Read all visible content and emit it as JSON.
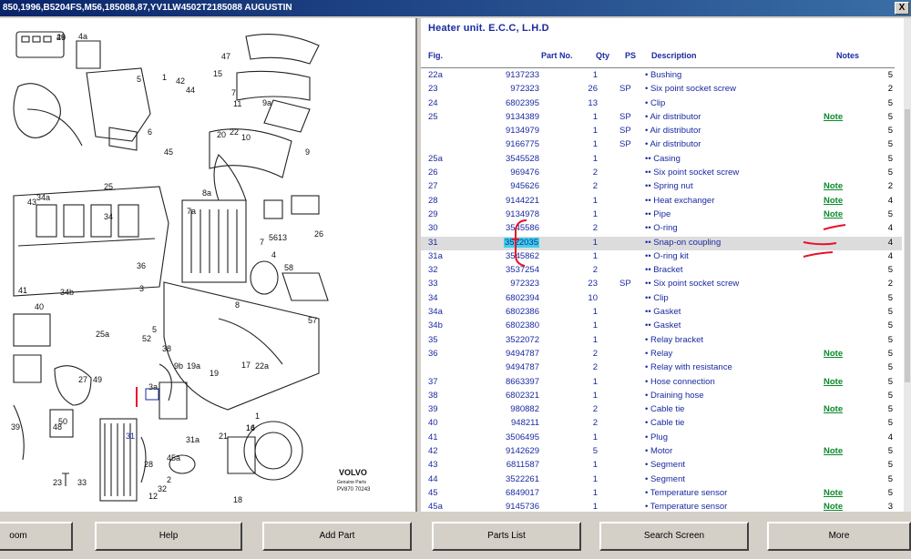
{
  "window": {
    "title": "850,1996,B5204FS,M56,185088,87,YV1LW4502T2185088 AUGUSTIN",
    "close_label": "X"
  },
  "diagram": {
    "callouts": [
      "46",
      "4a",
      "5",
      "1",
      "47",
      "15",
      "42",
      "44",
      "11",
      "9a",
      "7",
      "6",
      "10",
      "20",
      "22",
      "9",
      "45",
      "34a",
      "25",
      "8a",
      "7a",
      "34",
      "43",
      "4",
      "7",
      "56",
      "13",
      "26",
      "58",
      "57",
      "3",
      "41",
      "34b",
      "40",
      "25a",
      "38",
      "19",
      "52",
      "5",
      "17",
      "19a",
      "16",
      "21",
      "31a",
      "45a",
      "33",
      "23",
      "18",
      "49",
      "27",
      "39",
      "48",
      "50",
      "32",
      "2",
      "12",
      "14",
      "1",
      "36",
      "8",
      "9b",
      "22a",
      "3a",
      "31",
      "28",
      "29"
    ],
    "brand": "VOLVO",
    "brand_sub": "Genuine Parts",
    "code": "PV870 70243"
  },
  "parts": {
    "title": "Heater unit. E.C.C, L.H.D",
    "headers": {
      "fig": "Fig.",
      "part": "Part No.",
      "qty": "Qty",
      "ps": "PS",
      "desc": "Description",
      "notes": "Notes"
    },
    "rows": [
      {
        "fig": "22a",
        "part": "9137233",
        "qty": "1",
        "ps": "",
        "desc": "• Bushing",
        "note": "",
        "end": "5"
      },
      {
        "fig": "23",
        "part": "972323",
        "qty": "26",
        "ps": "SP",
        "desc": "• Six point socket screw",
        "note": "",
        "end": "2"
      },
      {
        "fig": "24",
        "part": "6802395",
        "qty": "13",
        "ps": "",
        "desc": "• Clip",
        "note": "",
        "end": "5"
      },
      {
        "fig": "25",
        "part": "9134389",
        "qty": "1",
        "ps": "SP",
        "desc": "• Air distributor",
        "note": "Note",
        "end": "5"
      },
      {
        "fig": "",
        "part": "9134979",
        "qty": "1",
        "ps": "SP",
        "desc": "• Air distributor",
        "note": "",
        "end": "5"
      },
      {
        "fig": "",
        "part": "9166775",
        "qty": "1",
        "ps": "SP",
        "desc": "• Air distributor",
        "note": "",
        "end": "5"
      },
      {
        "fig": "25a",
        "part": "3545528",
        "qty": "1",
        "ps": "",
        "desc": "•• Casing",
        "note": "",
        "end": "5"
      },
      {
        "fig": "26",
        "part": "969476",
        "qty": "2",
        "ps": "",
        "desc": "•• Six point socket screw",
        "note": "",
        "end": "5"
      },
      {
        "fig": "27",
        "part": "945626",
        "qty": "2",
        "ps": "",
        "desc": "•• Spring nut",
        "note": "Note",
        "end": "2"
      },
      {
        "fig": "28",
        "part": "9144221",
        "qty": "1",
        "ps": "",
        "desc": "•• Heat exchanger",
        "note": "Note",
        "end": "4"
      },
      {
        "fig": "29",
        "part": "9134978",
        "qty": "1",
        "ps": "",
        "desc": "•• Pipe",
        "note": "Note",
        "end": "5"
      },
      {
        "fig": "30",
        "part": "3545586",
        "qty": "2",
        "ps": "",
        "desc": "•• O-ring",
        "note": "",
        "end": "4"
      },
      {
        "fig": "31",
        "part": "3522035",
        "qty": "1",
        "ps": "",
        "desc": "•• Snap-on coupling",
        "note": "",
        "end": "4",
        "selected": true
      },
      {
        "fig": "31a",
        "part": "3545862",
        "qty": "1",
        "ps": "",
        "desc": "•• O-ring kit",
        "note": "",
        "end": "4"
      },
      {
        "fig": "32",
        "part": "3537254",
        "qty": "2",
        "ps": "",
        "desc": "•• Bracket",
        "note": "",
        "end": "5"
      },
      {
        "fig": "33",
        "part": "972323",
        "qty": "23",
        "ps": "SP",
        "desc": "•• Six point socket screw",
        "note": "",
        "end": "2"
      },
      {
        "fig": "34",
        "part": "6802394",
        "qty": "10",
        "ps": "",
        "desc": "•• Clip",
        "note": "",
        "end": "5"
      },
      {
        "fig": "34a",
        "part": "6802386",
        "qty": "1",
        "ps": "",
        "desc": "•• Gasket",
        "note": "",
        "end": "5"
      },
      {
        "fig": "34b",
        "part": "6802380",
        "qty": "1",
        "ps": "",
        "desc": "•• Gasket",
        "note": "",
        "end": "5"
      },
      {
        "fig": "35",
        "part": "3522072",
        "qty": "1",
        "ps": "",
        "desc": "• Relay bracket",
        "note": "",
        "end": "5"
      },
      {
        "fig": "36",
        "part": "9494787",
        "qty": "2",
        "ps": "",
        "desc": "• Relay",
        "note": "Note",
        "end": "5"
      },
      {
        "fig": "",
        "part": "9494787",
        "qty": "2",
        "ps": "",
        "desc": "• Relay with resistance",
        "note": "",
        "end": "5"
      },
      {
        "fig": "37",
        "part": "8663397",
        "qty": "1",
        "ps": "",
        "desc": "• Hose connection",
        "note": "Note",
        "end": "5"
      },
      {
        "fig": "38",
        "part": "6802321",
        "qty": "1",
        "ps": "",
        "desc": "• Draining hose",
        "note": "",
        "end": "5"
      },
      {
        "fig": "39",
        "part": "980882",
        "qty": "2",
        "ps": "",
        "desc": "• Cable tie",
        "note": "Note",
        "end": "5"
      },
      {
        "fig": "40",
        "part": "948211",
        "qty": "2",
        "ps": "",
        "desc": "• Cable tie",
        "note": "",
        "end": "5"
      },
      {
        "fig": "41",
        "part": "3506495",
        "qty": "1",
        "ps": "",
        "desc": "• Plug",
        "note": "",
        "end": "4"
      },
      {
        "fig": "42",
        "part": "9142629",
        "qty": "5",
        "ps": "",
        "desc": "• Motor",
        "note": "Note",
        "end": "5"
      },
      {
        "fig": "43",
        "part": "6811587",
        "qty": "1",
        "ps": "",
        "desc": "• Segment",
        "note": "",
        "end": "5"
      },
      {
        "fig": "44",
        "part": "3522261",
        "qty": "1",
        "ps": "",
        "desc": "• Segment",
        "note": "",
        "end": "5"
      },
      {
        "fig": "45",
        "part": "6849017",
        "qty": "1",
        "ps": "",
        "desc": "• Temperature sensor",
        "note": "Note",
        "end": "5"
      },
      {
        "fig": "45a",
        "part": "9145736",
        "qty": "1",
        "ps": "",
        "desc": "• Temperature sensor",
        "note": "Note",
        "end": "3"
      }
    ]
  },
  "buttons": [
    "oom",
    "Help",
    "Add Part",
    "Parts List",
    "Search Screen",
    "More"
  ],
  "colors": {
    "text_blue": "#1a2aa0",
    "note_green": "#0a8a2a",
    "highlight": "#3fd0e8",
    "annotation_red": "#e8102a"
  }
}
